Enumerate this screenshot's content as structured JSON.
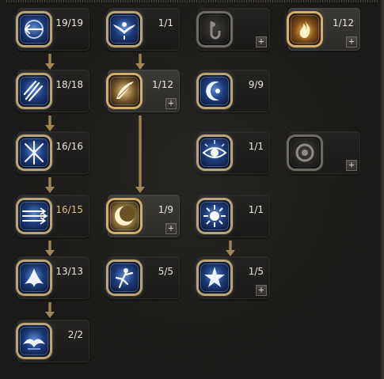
{
  "skill_tree": {
    "nodes": [
      {
        "id": "skill-r1c1",
        "rank": "19/19",
        "icon": "arrow-whirl-icon"
      },
      {
        "id": "skill-r1c2",
        "rank": "1/1",
        "icon": "winged-spirit-icon"
      },
      {
        "id": "skill-r1c3",
        "rank": "",
        "icon": "locked-skill-icon"
      },
      {
        "id": "skill-r1c4",
        "rank": "1/12",
        "icon": "flame-burst-icon"
      },
      {
        "id": "skill-r2c1",
        "rank": "18/18",
        "icon": "triple-slash-icon"
      },
      {
        "id": "skill-r2c2",
        "rank": "1/12",
        "icon": "feather-wing-icon"
      },
      {
        "id": "skill-r2c3",
        "rank": "9/9",
        "icon": "crescent-spirit-icon"
      },
      {
        "id": "skill-r3c1",
        "rank": "16/16",
        "icon": "cross-arrows-icon"
      },
      {
        "id": "skill-r3c3",
        "rank": "1/1",
        "icon": "all-seeing-eye-icon"
      },
      {
        "id": "skill-r3c4",
        "rank": "",
        "icon": "locked-ring-icon"
      },
      {
        "id": "skill-r4c1",
        "rank": "16/15",
        "icon": "arrow-volley-icon"
      },
      {
        "id": "skill-r4c2",
        "rank": "1/9",
        "icon": "eclipse-moon-icon"
      },
      {
        "id": "skill-r4c3",
        "rank": "1/1",
        "icon": "radiant-burst-icon"
      },
      {
        "id": "skill-r5c1",
        "rank": "13/13",
        "icon": "phoenix-icon"
      },
      {
        "id": "skill-r5c2",
        "rank": "5/5",
        "icon": "dancing-spirit-icon"
      },
      {
        "id": "skill-r5c3",
        "rank": "1/5",
        "icon": "star-spirit-icon"
      },
      {
        "id": "skill-r6c1",
        "rank": "2/2",
        "icon": "spirit-bird-icon"
      }
    ],
    "plus_label": "+"
  }
}
